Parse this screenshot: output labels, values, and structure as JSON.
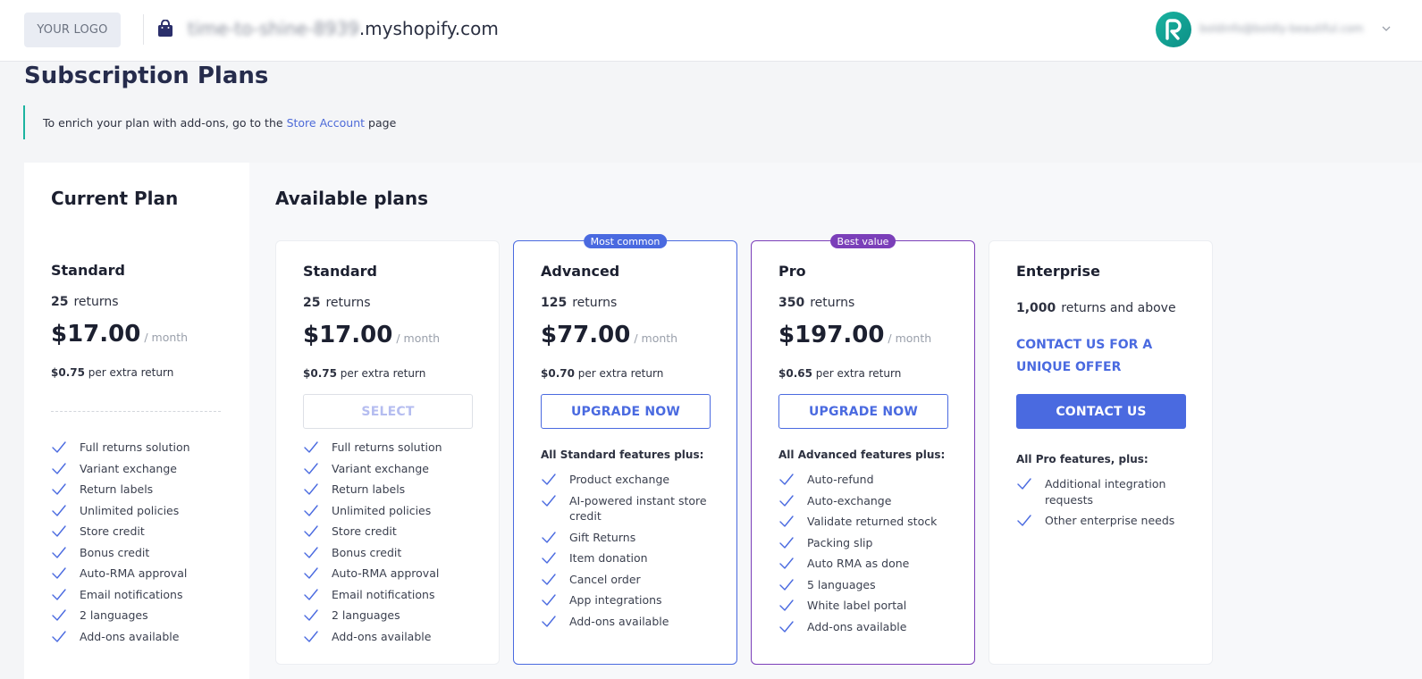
{
  "header": {
    "logo": "YOUR LOGO",
    "domain_blurred": "time-to-shine-8939",
    "domain_suffix": ".myshopify.com",
    "user_email": "boldinfo@boldly-beautiful.com"
  },
  "page": {
    "title": "Subscription Plans",
    "notice_before": "To enrich your plan with add-ons, go to the",
    "notice_link": "Store Account",
    "notice_after": "page"
  },
  "current_plan": {
    "heading": "Current Plan",
    "name": "Standard",
    "returns_count": "25",
    "returns_label": "returns",
    "price": "$17.00",
    "per": "/ month",
    "extra_price": "$0.75",
    "extra_label": "per extra return",
    "features": [
      "Full returns solution",
      "Variant exchange",
      "Return labels",
      "Unlimited policies",
      "Store credit",
      "Bonus credit",
      "Auto-RMA approval",
      "Email notifications",
      "2 languages",
      "Add-ons available"
    ]
  },
  "available": {
    "heading": "Available plans",
    "plans": [
      {
        "name": "Standard",
        "returns_count": "25",
        "returns_label": "returns",
        "price": "$17.00",
        "per": "/ month",
        "extra_price": "$0.75",
        "extra_label": "per extra return",
        "button": "SELECT",
        "features": [
          "Full returns solution",
          "Variant exchange",
          "Return labels",
          "Unlimited policies",
          "Store credit",
          "Bonus credit",
          "Auto-RMA approval",
          "Email notifications",
          "2 languages",
          "Add-ons available"
        ]
      },
      {
        "badge": "Most common",
        "name": "Advanced",
        "returns_count": "125",
        "returns_label": "returns",
        "price": "$77.00",
        "per": "/ month",
        "extra_price": "$0.70",
        "extra_label": "per extra return",
        "button": "UPGRADE NOW",
        "plus_heading": "All Standard features plus:",
        "features": [
          "Product exchange",
          "AI-powered instant store credit",
          "Gift Returns",
          "Item donation",
          "Cancel order",
          "App integrations",
          "Add-ons available"
        ]
      },
      {
        "badge": "Best value",
        "name": "Pro",
        "returns_count": "350",
        "returns_label": "returns",
        "price": "$197.00",
        "per": "/ month",
        "extra_price": "$0.65",
        "extra_label": "per extra return",
        "button": "UPGRADE NOW",
        "plus_heading": "All Advanced features plus:",
        "features": [
          "Auto-refund",
          "Auto-exchange",
          "Validate returned stock",
          "Packing slip",
          "Auto RMA as done",
          "5 languages",
          "White label portal",
          "Add-ons available"
        ]
      },
      {
        "name": "Enterprise",
        "returns_count": "1,000",
        "returns_label": "returns and above",
        "contact_offer": "CONTACT US FOR A UNIQUE OFFER",
        "button": "CONTACT US",
        "plus_heading": "All Pro features, plus:",
        "features": [
          "Additional integration requests",
          "Other enterprise needs"
        ]
      }
    ]
  },
  "colors": {
    "accent": "#4a6ae0",
    "best_value": "#7b3fb9",
    "teal": "#1cb3a0",
    "title": "#262c4c"
  }
}
